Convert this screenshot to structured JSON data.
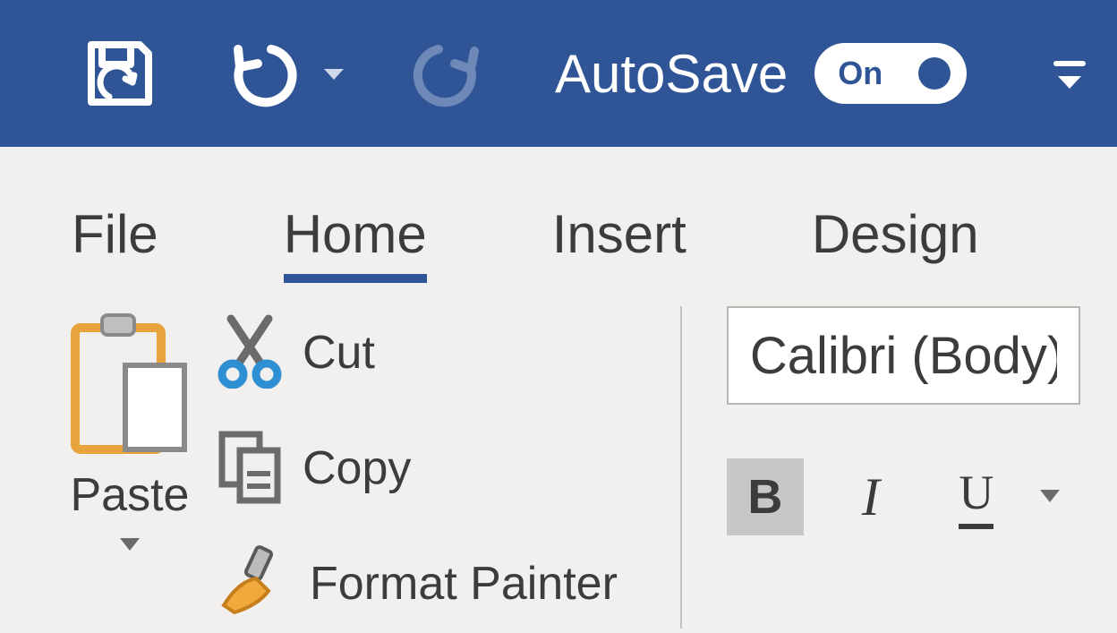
{
  "titlebar": {
    "autosave_label": "AutoSave",
    "autosave_state": "On"
  },
  "tabs": {
    "file": "File",
    "home": "Home",
    "insert": "Insert",
    "design": "Design",
    "active": "home"
  },
  "clipboard": {
    "paste_label": "Paste",
    "cut_label": "Cut",
    "copy_label": "Copy",
    "format_painter_label": "Format Painter"
  },
  "font": {
    "font_name": "Calibri (Body)",
    "bold": "B",
    "italic": "I",
    "underline": "U"
  },
  "colors": {
    "brand": "#2f5597"
  }
}
